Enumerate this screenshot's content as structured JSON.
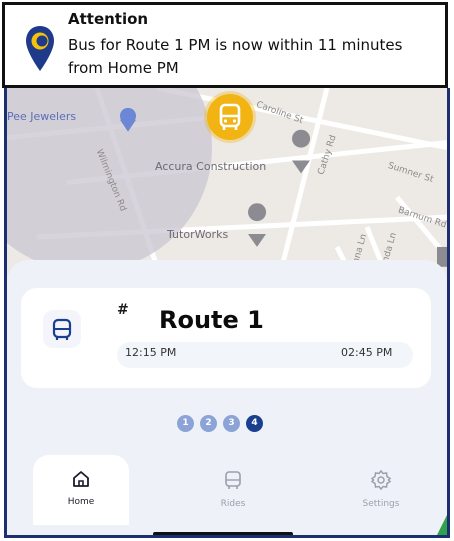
{
  "notification": {
    "title": "Attention",
    "message": "Bus for Route 1 PM is now within 11 minutes from Home PM"
  },
  "map": {
    "places": [
      "Pee Jewelers",
      "Accura Construction",
      "TutorWorks"
    ],
    "streets": [
      "Wilmington Rd",
      "Caroline St",
      "Cathy Rd",
      "Sumner St",
      "Barnum Rd",
      "Donna Ln",
      "Brenda Ln"
    ]
  },
  "route_card": {
    "hash": "#",
    "title": "Route 1",
    "start_time": "12:15 PM",
    "end_time": "02:45 PM"
  },
  "pager": {
    "pages": [
      "1",
      "2",
      "3",
      "4"
    ],
    "active": "4"
  },
  "tabs": [
    {
      "label": "Home"
    },
    {
      "label": "Rides"
    },
    {
      "label": "Settings"
    }
  ],
  "colors": {
    "accent": "#1a3f8f",
    "bus_marker": "#f2b413",
    "frame": "#1c2f6e"
  }
}
